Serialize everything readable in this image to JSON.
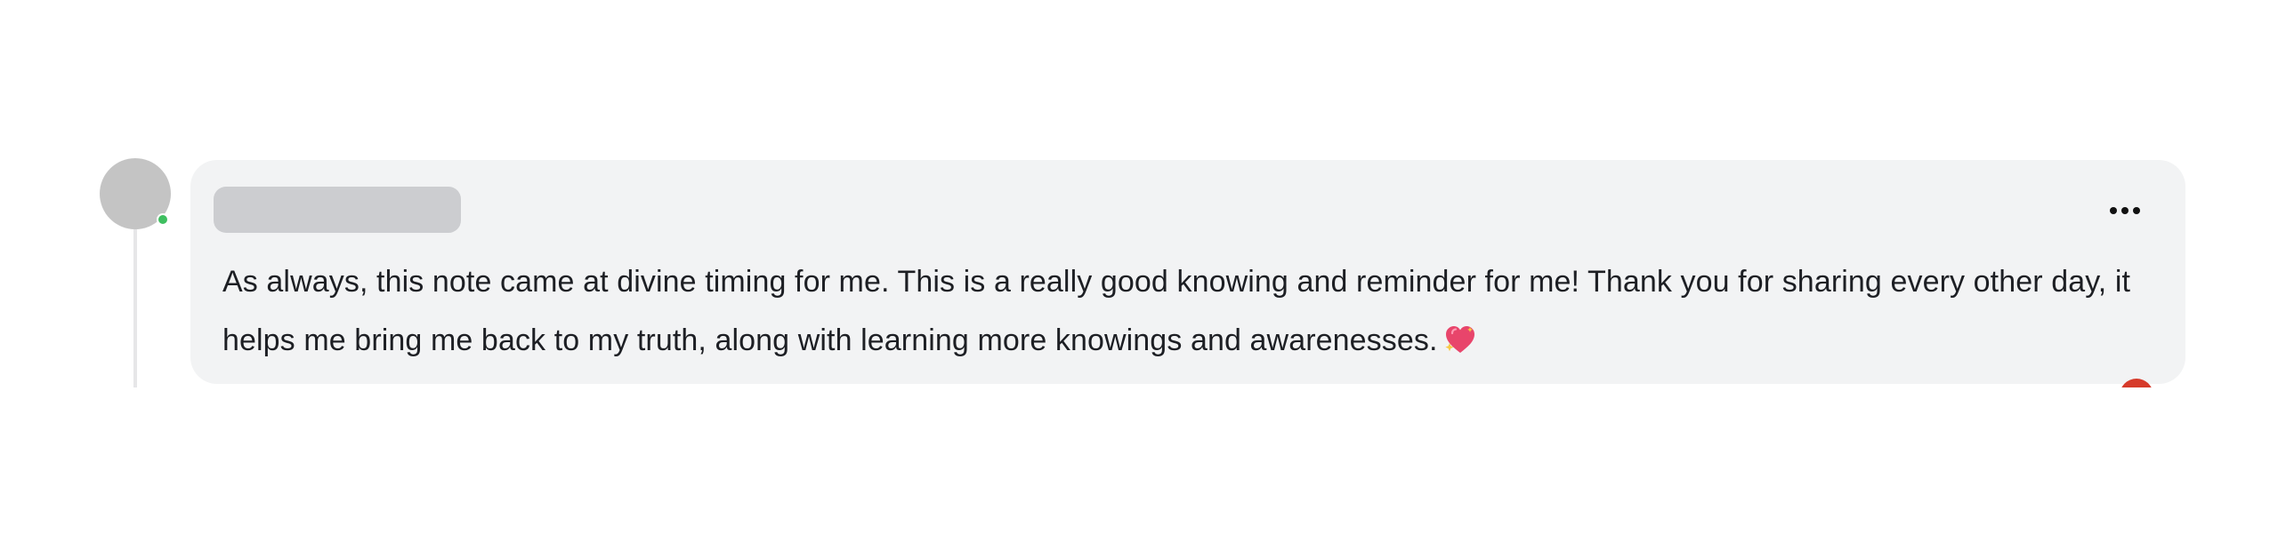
{
  "comment": {
    "author_name": "",
    "author_online": true,
    "text": "As always, this note came at divine timing for me. This is a really good knowing and reminder for me! Thank you for sharing every other day, it helps me bring me back to my truth, along with learning more knowings and awarenesses.",
    "emoji_icon": "sparkling-heart-icon",
    "menu_icon": "more-options-icon",
    "reaction_icon": "reaction-badge-icon"
  },
  "colors": {
    "bubble_background": "#f2f3f4",
    "text": "#1d1f24",
    "avatar_placeholder": "#c4c4c4",
    "online_indicator": "#3fbf60",
    "reaction_badge": "#d63a2a"
  }
}
